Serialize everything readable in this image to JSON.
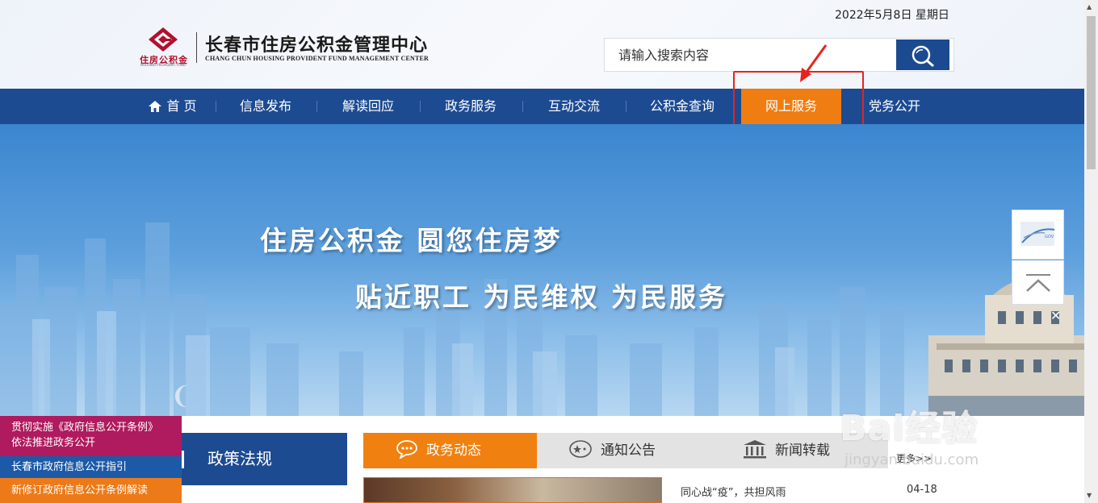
{
  "header": {
    "date": "2022年5月8日 星期日",
    "logo_cn": "住房公积金",
    "logo_en": "HOUSING PROVIDENT FUND",
    "title": "长春市住房公积金管理中心",
    "subtitle": "CHANG CHUN HOUSING PROVIDENT FUND MANAGEMENT CENTER"
  },
  "search": {
    "placeholder": "请输入搜索内容"
  },
  "nav": {
    "items": [
      {
        "label": "首 页"
      },
      {
        "label": "信息发布"
      },
      {
        "label": "解读回应"
      },
      {
        "label": "政务服务"
      },
      {
        "label": "互动交流"
      },
      {
        "label": "公积金查询"
      },
      {
        "label": "网上服务"
      },
      {
        "label": "党务公开"
      }
    ],
    "active": "网上服务"
  },
  "banner": {
    "slogan1": "住房公积金  圆您住房梦",
    "slogan2": "贴近职工  为民维权  为民服务"
  },
  "policy_tab": {
    "label": "政策法规"
  },
  "tabs": [
    {
      "label": "政务动态"
    },
    {
      "label": "通知公告"
    },
    {
      "label": "新闻转载"
    }
  ],
  "more_label": "更多>>",
  "news": [
    {
      "title": "同心战“疫”，共担风雨",
      "date": "04-18"
    }
  ],
  "notices": {
    "n1_line1": "贯彻实施《政府信息公开条例》",
    "n1_line2": "依法推进政务公开",
    "n2": "长春市政府信息公开指引",
    "n3": "新修订政府信息公开条例解读"
  },
  "watermark": {
    "text": "Bai经验",
    "sub": "jingyan.baidu.com"
  },
  "colors": {
    "nav_blue": "#1c4b92",
    "accent_orange": "#ef7d12",
    "highlight_red": "#e8231d"
  }
}
